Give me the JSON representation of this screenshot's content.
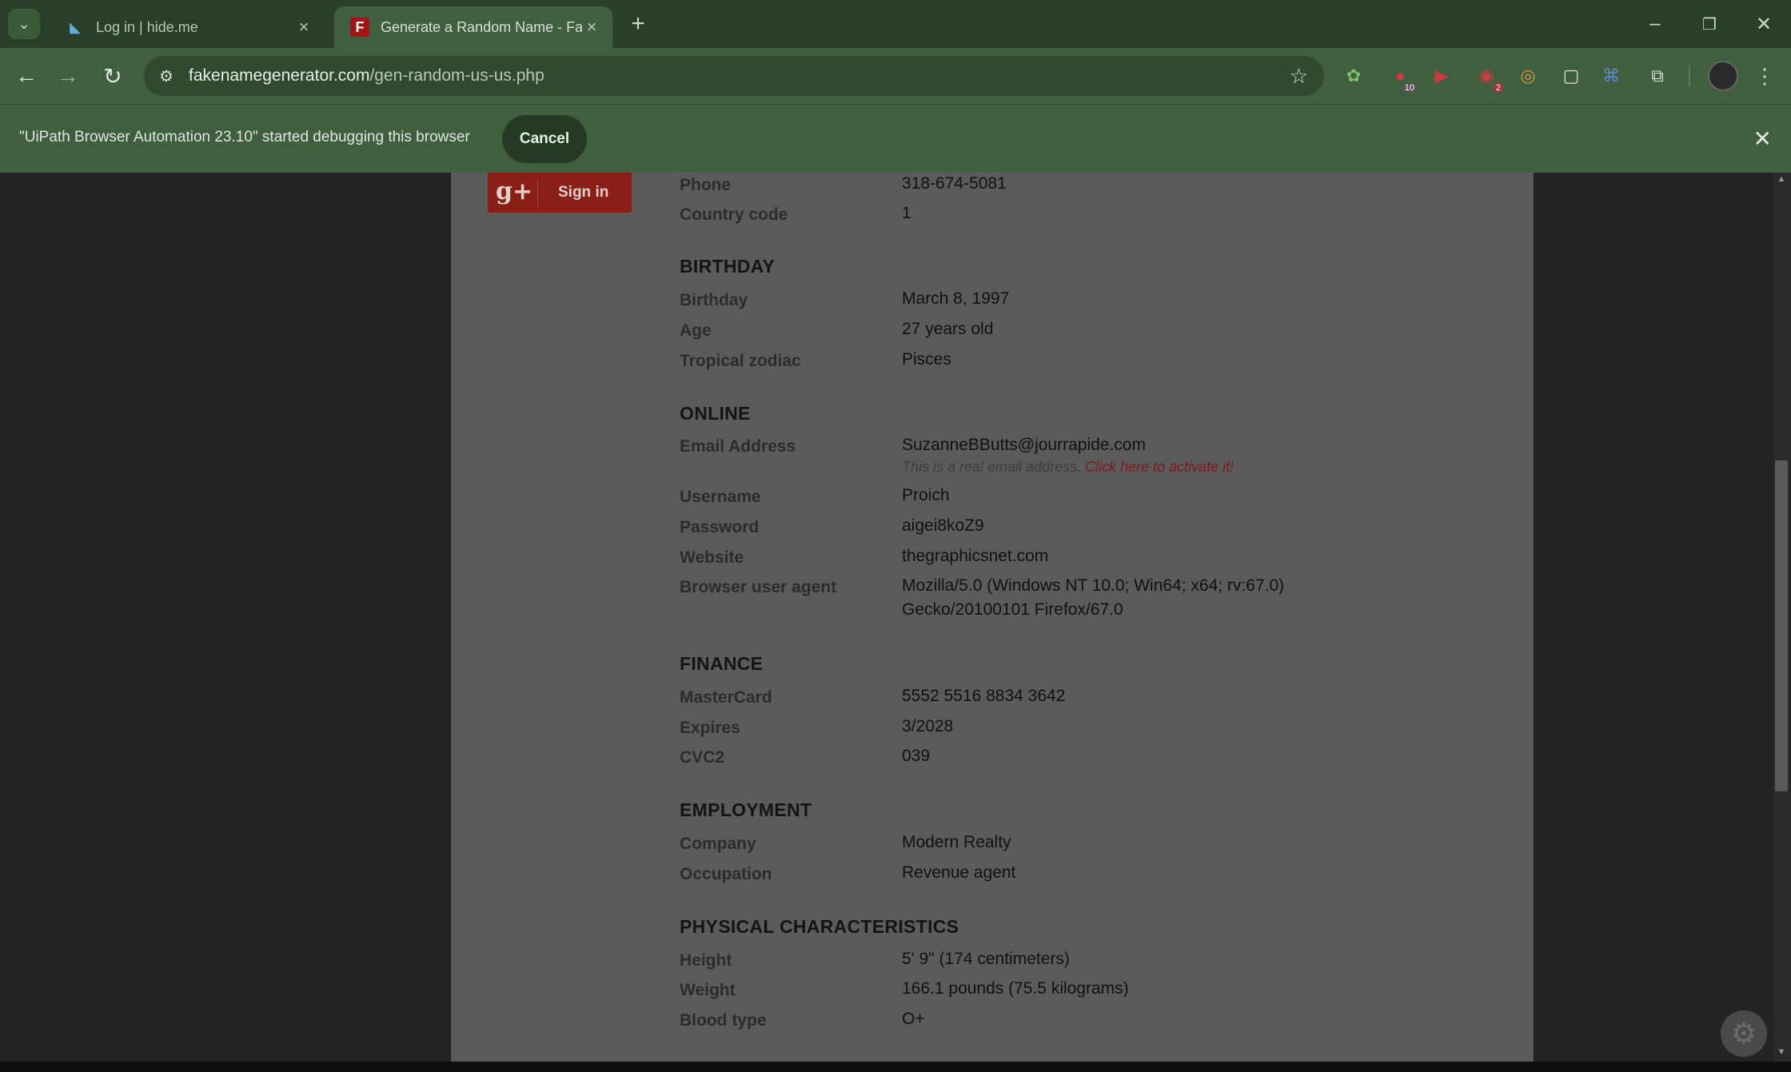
{
  "browser": {
    "tabs": [
      {
        "title": "Log in | hide.me",
        "active": false
      },
      {
        "title": "Generate a Random Name - Fa",
        "active": true
      }
    ],
    "url_host": "fakenamegenerator.com",
    "url_path": "/gen-random-us-us.php",
    "extension_badges": {
      "ext2": "10",
      "ext4": "2"
    }
  },
  "infobar": {
    "message": "\"UiPath Browser Automation 23.10\" started debugging this browser",
    "cancel_label": "Cancel"
  },
  "signin": {
    "glyph": "g+",
    "label": "Sign in"
  },
  "identity": {
    "phone_label": "Phone",
    "phone": "318-674-5081",
    "country_code_label": "Country code",
    "country_code": "1"
  },
  "birthday": {
    "title": "BIRTHDAY",
    "birthday_label": "Birthday",
    "birthday": "March 8, 1997",
    "age_label": "Age",
    "age": "27 years old",
    "zodiac_label": "Tropical zodiac",
    "zodiac": "Pisces"
  },
  "online": {
    "title": "ONLINE",
    "email_label": "Email Address",
    "email": "SuzanneBButts@jourrapide.com",
    "email_note": "This is a real email address.",
    "email_note_link": "Click here to activate it!",
    "username_label": "Username",
    "username": "Proich",
    "password_label": "Password",
    "password": "aigei8koZ9",
    "website_label": "Website",
    "website": "thegraphicsnet.com",
    "ua_label": "Browser user agent",
    "ua_line1": "Mozilla/5.0 (Windows NT 10.0; Win64; x64; rv:67.0)",
    "ua_line2": "Gecko/20100101 Firefox/67.0"
  },
  "finance": {
    "title": "FINANCE",
    "card_label": "MasterCard",
    "card": "5552 5516 8834 3642",
    "expires_label": "Expires",
    "expires": "3/2028",
    "cvc_label": "CVC2",
    "cvc": "039"
  },
  "employment": {
    "title": "EMPLOYMENT",
    "company_label": "Company",
    "company": "Modern Realty",
    "occupation_label": "Occupation",
    "occupation": "Revenue agent"
  },
  "physical": {
    "title": "PHYSICAL CHARACTERISTICS",
    "height_label": "Height",
    "height": "5' 9\" (174 centimeters)",
    "weight_label": "Weight",
    "weight": "166.1 pounds (75.5 kilograms)",
    "blood_label": "Blood type",
    "blood": "O+"
  }
}
